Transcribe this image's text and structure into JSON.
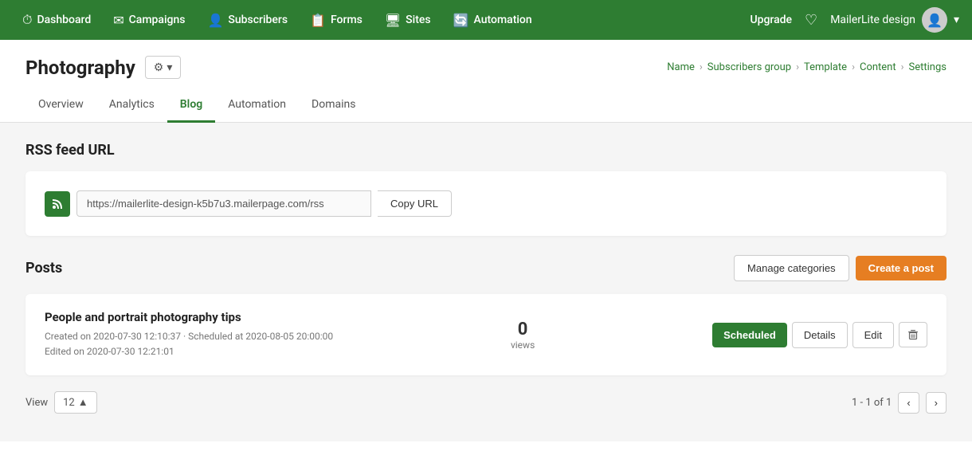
{
  "nav": {
    "items": [
      {
        "id": "dashboard",
        "label": "Dashboard",
        "icon": "⏱"
      },
      {
        "id": "campaigns",
        "label": "Campaigns",
        "icon": "✉"
      },
      {
        "id": "subscribers",
        "label": "Subscribers",
        "icon": "👤"
      },
      {
        "id": "forms",
        "label": "Forms",
        "icon": "📋"
      },
      {
        "id": "sites",
        "label": "Sites",
        "icon": "🖥"
      },
      {
        "id": "automation",
        "label": "Automation",
        "icon": "🔄"
      }
    ],
    "upgrade_label": "Upgrade",
    "user_name": "MailerLite design"
  },
  "breadcrumb": {
    "items": [
      {
        "label": "Name"
      },
      {
        "label": "Subscribers group"
      },
      {
        "label": "Template"
      },
      {
        "label": "Content"
      },
      {
        "label": "Settings"
      }
    ]
  },
  "page": {
    "title": "Photography",
    "settings_label": "⚙",
    "tabs": [
      {
        "id": "overview",
        "label": "Overview"
      },
      {
        "id": "analytics",
        "label": "Analytics"
      },
      {
        "id": "blog",
        "label": "Blog",
        "active": true
      },
      {
        "id": "automation",
        "label": "Automation"
      },
      {
        "id": "domains",
        "label": "Domains"
      }
    ]
  },
  "rss": {
    "section_title": "RSS feed URL",
    "url_value": "https://mailerlite-design-k5b7u3.mailerpage.com/rss",
    "copy_button_label": "Copy URL",
    "icon": "■"
  },
  "posts": {
    "section_title": "Posts",
    "manage_categories_label": "Manage categories",
    "create_post_label": "Create a post",
    "items": [
      {
        "title": "People and portrait photography tips",
        "created": "Created on 2020-07-30 12:10:37 · Scheduled at 2020-08-05 20:00:00",
        "edited": "Edited on 2020-07-30 12:21:01",
        "views": 0,
        "views_label": "views",
        "status": "Scheduled",
        "details_label": "Details",
        "edit_label": "Edit"
      }
    ]
  },
  "pagination": {
    "view_label": "View",
    "per_page": "12",
    "info": "1 - 1 of 1"
  }
}
